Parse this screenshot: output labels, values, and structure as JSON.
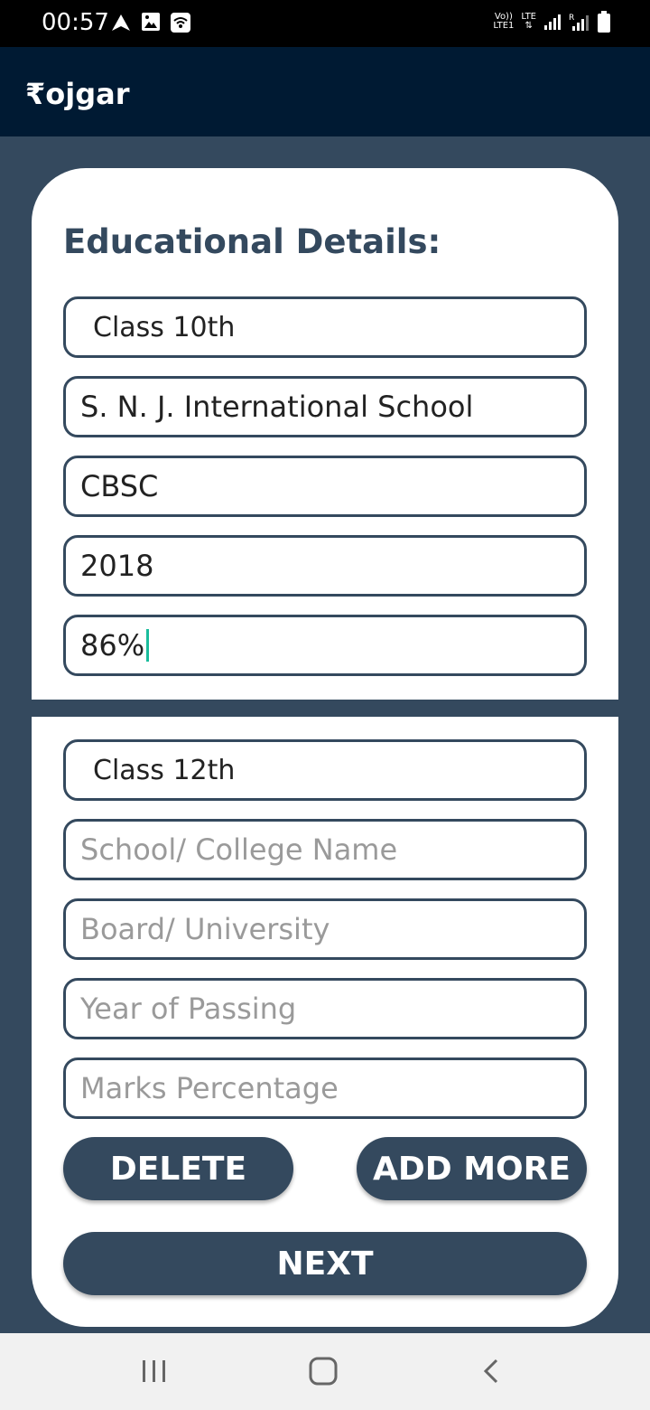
{
  "status_bar": {
    "time": "00:57",
    "network_label_top": "Vo))",
    "network_label_bottom": "LTE1",
    "lte_label": "LTE",
    "icons": [
      "navigation-arrow-icon",
      "image-icon",
      "wifi-icon",
      "signal-icon",
      "signal-r-icon",
      "battery-icon"
    ]
  },
  "app": {
    "title": "₹ojgar"
  },
  "education": {
    "heading": "Educational Details:",
    "entry1": {
      "class": "Class 10th",
      "school": "S. N. J. International School",
      "board": "CBSC",
      "year": "2018",
      "marks": "86%"
    },
    "entry2": {
      "class": "Class 12th",
      "school_placeholder": "School/ College Name",
      "board_placeholder": "Board/ University",
      "year_placeholder": "Year of Passing",
      "marks_placeholder": "Marks Percentage"
    },
    "delete_label": "DELETE",
    "add_more_label": "ADD MORE",
    "next_label": "NEXT"
  },
  "colors": {
    "primary": "#34495e",
    "app_bar": "#001a33",
    "cursor": "#1abc9c"
  },
  "nav_bar": {
    "icons": [
      "recent-apps-icon",
      "home-icon",
      "back-icon"
    ]
  }
}
